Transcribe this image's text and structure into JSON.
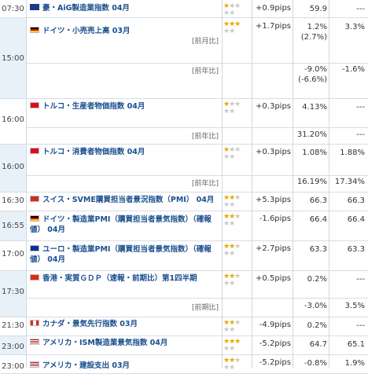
{
  "rows": [
    {
      "time": "07:30",
      "flag": "au",
      "name": "豪・AiG製造業指数 04月",
      "stars": 1,
      "pips": "+0.9pips",
      "value": "59.9",
      "prev": "---"
    },
    {
      "time": "15:00",
      "flag": "de",
      "name": "ドイツ・小売売上高 03月",
      "sub": "[前月比]",
      "stars": 3,
      "pips": "+1.7pips",
      "value": "1.2% (2.7%)",
      "prev": "3.3%"
    },
    {
      "sub": "[前年比]",
      "value": "-9.0% (-6.6%)",
      "prev": "-1.6%"
    },
    {
      "time": "16:00",
      "flag": "tr",
      "name": "トルコ・生産者物価指数 04月",
      "stars": 1,
      "pips": "+0.3pips",
      "value": "4.13%",
      "prev": "---"
    },
    {
      "sub": "[前年比]",
      "value": "31.20%",
      "prev": "---"
    },
    {
      "time": "16:00",
      "flag": "tr",
      "name": "トルコ・消費者物価指数 04月",
      "stars": 1,
      "pips": "+0.3pips",
      "value": "1.08%",
      "prev": "1.88%"
    },
    {
      "sub": "[前年比]",
      "value": "16.19%",
      "prev": "17.34%"
    },
    {
      "time": "16:30",
      "flag": "ch",
      "name": "スイス・SVME購買担当者景況指数（PMI） 04月",
      "stars": 2,
      "pips": "+5.3pips",
      "value": "66.3",
      "prev": "66.3"
    },
    {
      "time": "16:55",
      "flag": "de",
      "name": "ドイツ・製造業PMI（購買担当者景気指数）（確報値） 04月",
      "stars": 2,
      "pips": "-1.6pips",
      "value": "66.4",
      "prev": "66.4"
    },
    {
      "time": "17:00",
      "flag": "eu",
      "name": "ユーロ・製造業PMI（購買担当者景気指数）（確報値） 04月",
      "stars": 2,
      "pips": "+2.7pips",
      "value": "63.3",
      "prev": "63.3"
    },
    {
      "time": "17:30",
      "flag": "hk",
      "name": "香港・実質ＧＤＰ（速報・前期比）第1四半期",
      "stars": 2,
      "pips": "+0.5pips",
      "value": "0.2%",
      "prev": "---"
    },
    {
      "sub": "[前期比]",
      "value": "-3.0%",
      "prev": "3.5%"
    },
    {
      "time": "21:30",
      "flag": "ca",
      "name": "カナダ・景気先行指数 03月",
      "stars": 2,
      "pips": "-4.9pips",
      "value": "0.2%",
      "prev": "---"
    },
    {
      "time": "23:00",
      "flag": "us",
      "name": "アメリカ・ISM製造業景気指数 04月",
      "stars": 3,
      "pips": "-5.2pips",
      "value": "64.7",
      "prev": "65.1"
    },
    {
      "time": "23:00",
      "flag": "us",
      "name": "アメリカ・建設支出 03月",
      "stars": 2,
      "pips": "-5.2pips",
      "value": "-0.8%",
      "prev": "1.9%"
    }
  ],
  "colors": {
    "accent": "#1a4f8f",
    "star_on": "#e6a700",
    "time_bg": "#e9f1f8"
  }
}
